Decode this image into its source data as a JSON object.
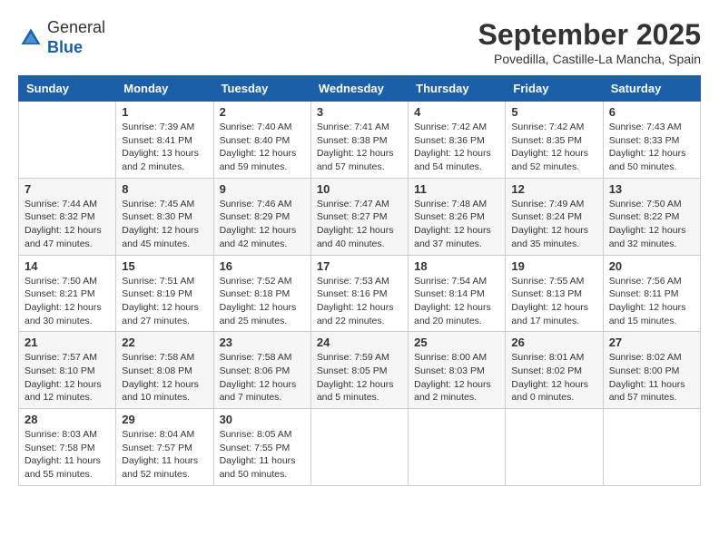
{
  "logo": {
    "general": "General",
    "blue": "Blue"
  },
  "title": {
    "month_year": "September 2025",
    "location": "Povedilla, Castille-La Mancha, Spain"
  },
  "days_of_week": [
    "Sunday",
    "Monday",
    "Tuesday",
    "Wednesday",
    "Thursday",
    "Friday",
    "Saturday"
  ],
  "weeks": [
    [
      {
        "day": "",
        "info": ""
      },
      {
        "day": "1",
        "info": "Sunrise: 7:39 AM\nSunset: 8:41 PM\nDaylight: 13 hours\nand 2 minutes."
      },
      {
        "day": "2",
        "info": "Sunrise: 7:40 AM\nSunset: 8:40 PM\nDaylight: 12 hours\nand 59 minutes."
      },
      {
        "day": "3",
        "info": "Sunrise: 7:41 AM\nSunset: 8:38 PM\nDaylight: 12 hours\nand 57 minutes."
      },
      {
        "day": "4",
        "info": "Sunrise: 7:42 AM\nSunset: 8:36 PM\nDaylight: 12 hours\nand 54 minutes."
      },
      {
        "day": "5",
        "info": "Sunrise: 7:42 AM\nSunset: 8:35 PM\nDaylight: 12 hours\nand 52 minutes."
      },
      {
        "day": "6",
        "info": "Sunrise: 7:43 AM\nSunset: 8:33 PM\nDaylight: 12 hours\nand 50 minutes."
      }
    ],
    [
      {
        "day": "7",
        "info": "Sunrise: 7:44 AM\nSunset: 8:32 PM\nDaylight: 12 hours\nand 47 minutes."
      },
      {
        "day": "8",
        "info": "Sunrise: 7:45 AM\nSunset: 8:30 PM\nDaylight: 12 hours\nand 45 minutes."
      },
      {
        "day": "9",
        "info": "Sunrise: 7:46 AM\nSunset: 8:29 PM\nDaylight: 12 hours\nand 42 minutes."
      },
      {
        "day": "10",
        "info": "Sunrise: 7:47 AM\nSunset: 8:27 PM\nDaylight: 12 hours\nand 40 minutes."
      },
      {
        "day": "11",
        "info": "Sunrise: 7:48 AM\nSunset: 8:26 PM\nDaylight: 12 hours\nand 37 minutes."
      },
      {
        "day": "12",
        "info": "Sunrise: 7:49 AM\nSunset: 8:24 PM\nDaylight: 12 hours\nand 35 minutes."
      },
      {
        "day": "13",
        "info": "Sunrise: 7:50 AM\nSunset: 8:22 PM\nDaylight: 12 hours\nand 32 minutes."
      }
    ],
    [
      {
        "day": "14",
        "info": "Sunrise: 7:50 AM\nSunset: 8:21 PM\nDaylight: 12 hours\nand 30 minutes."
      },
      {
        "day": "15",
        "info": "Sunrise: 7:51 AM\nSunset: 8:19 PM\nDaylight: 12 hours\nand 27 minutes."
      },
      {
        "day": "16",
        "info": "Sunrise: 7:52 AM\nSunset: 8:18 PM\nDaylight: 12 hours\nand 25 minutes."
      },
      {
        "day": "17",
        "info": "Sunrise: 7:53 AM\nSunset: 8:16 PM\nDaylight: 12 hours\nand 22 minutes."
      },
      {
        "day": "18",
        "info": "Sunrise: 7:54 AM\nSunset: 8:14 PM\nDaylight: 12 hours\nand 20 minutes."
      },
      {
        "day": "19",
        "info": "Sunrise: 7:55 AM\nSunset: 8:13 PM\nDaylight: 12 hours\nand 17 minutes."
      },
      {
        "day": "20",
        "info": "Sunrise: 7:56 AM\nSunset: 8:11 PM\nDaylight: 12 hours\nand 15 minutes."
      }
    ],
    [
      {
        "day": "21",
        "info": "Sunrise: 7:57 AM\nSunset: 8:10 PM\nDaylight: 12 hours\nand 12 minutes."
      },
      {
        "day": "22",
        "info": "Sunrise: 7:58 AM\nSunset: 8:08 PM\nDaylight: 12 hours\nand 10 minutes."
      },
      {
        "day": "23",
        "info": "Sunrise: 7:58 AM\nSunset: 8:06 PM\nDaylight: 12 hours\nand 7 minutes."
      },
      {
        "day": "24",
        "info": "Sunrise: 7:59 AM\nSunset: 8:05 PM\nDaylight: 12 hours\nand 5 minutes."
      },
      {
        "day": "25",
        "info": "Sunrise: 8:00 AM\nSunset: 8:03 PM\nDaylight: 12 hours\nand 2 minutes."
      },
      {
        "day": "26",
        "info": "Sunrise: 8:01 AM\nSunset: 8:02 PM\nDaylight: 12 hours\nand 0 minutes."
      },
      {
        "day": "27",
        "info": "Sunrise: 8:02 AM\nSunset: 8:00 PM\nDaylight: 11 hours\nand 57 minutes."
      }
    ],
    [
      {
        "day": "28",
        "info": "Sunrise: 8:03 AM\nSunset: 7:58 PM\nDaylight: 11 hours\nand 55 minutes."
      },
      {
        "day": "29",
        "info": "Sunrise: 8:04 AM\nSunset: 7:57 PM\nDaylight: 11 hours\nand 52 minutes."
      },
      {
        "day": "30",
        "info": "Sunrise: 8:05 AM\nSunset: 7:55 PM\nDaylight: 11 hours\nand 50 minutes."
      },
      {
        "day": "",
        "info": ""
      },
      {
        "day": "",
        "info": ""
      },
      {
        "day": "",
        "info": ""
      },
      {
        "day": "",
        "info": ""
      }
    ]
  ]
}
